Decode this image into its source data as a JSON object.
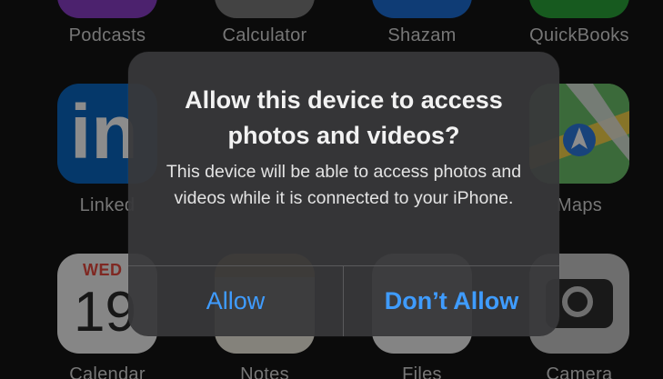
{
  "home_screen": {
    "top_row_labels": [
      "Podcasts",
      "Calculator",
      "Shazam",
      "QuickBooks"
    ],
    "middle_row_labels": [
      "Linked",
      "Maps"
    ],
    "bottom_row_labels": [
      "Calendar",
      "Notes",
      "Files",
      "Camera"
    ],
    "calendar_day": "WED",
    "calendar_date": "19",
    "linkedin_glyph": "in"
  },
  "alert": {
    "title": "Allow this device to access photos and videos?",
    "message": "This device will be able to access photos and videos while it is connected to your iPhone.",
    "allow_label": "Allow",
    "dont_allow_label": "Don’t Allow"
  },
  "colors": {
    "button_blue": "#3f9cff",
    "alert_background": "#38383a"
  }
}
